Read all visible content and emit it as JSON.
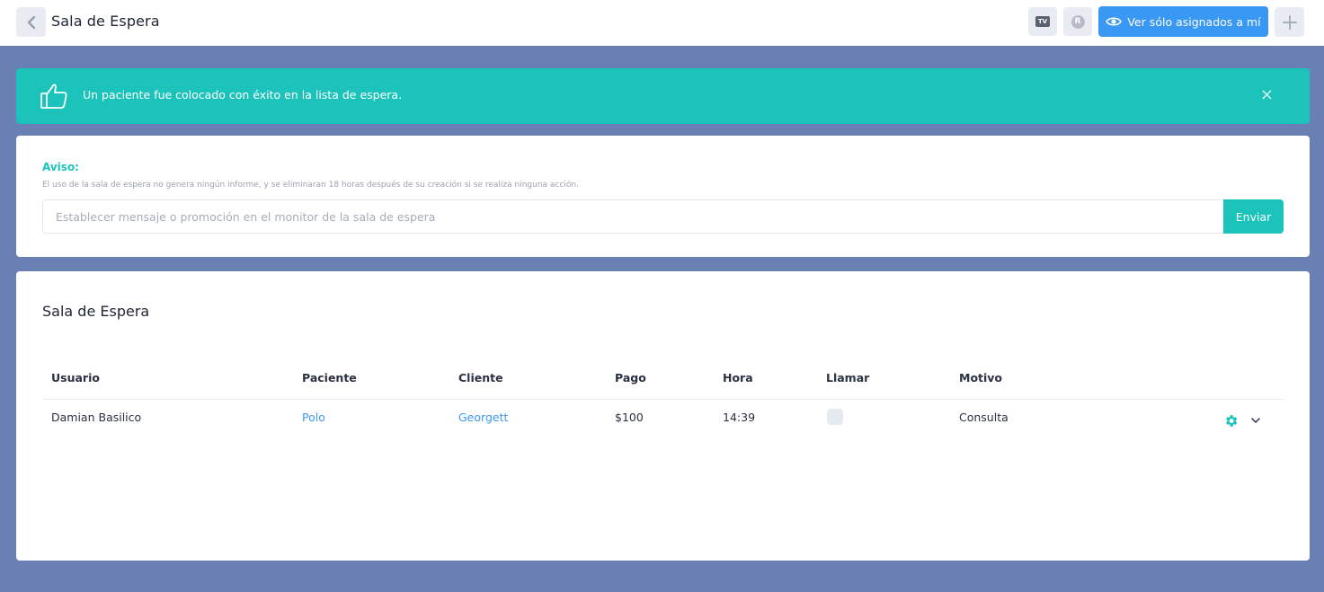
{
  "header": {
    "title": "Sala de Espera",
    "tv_label": "TV",
    "r_label": "R",
    "assigned_button": "Ver sólo asignados a mí"
  },
  "alert": {
    "message": "Un paciente fue colocado con éxito en la lista de espera.",
    "close": "×"
  },
  "notice": {
    "title": "Aviso:",
    "description": "El uso de la sala de espera no genera ningún informe, y se eliminaran 18 horas después de su creación si se realiza ninguna acción.",
    "input_placeholder": "Establecer mensaje o promoción en el monitor de la sala de espera",
    "input_value": "",
    "send_button": "Enviar"
  },
  "waiting_room": {
    "title": "Sala de Espera",
    "columns": [
      "Usuario",
      "Paciente",
      "Cliente",
      "Pago",
      "Hora",
      "Llamar",
      "Motivo"
    ],
    "rows": [
      {
        "usuario": "Damian Basilico",
        "paciente": "Polo",
        "cliente": "Georgett",
        "pago": "$100",
        "hora": "14:39",
        "llamar": false,
        "motivo": "Consulta"
      }
    ]
  },
  "colors": {
    "accent_teal": "#1cc3bb",
    "primary_blue": "#3a98f5",
    "background": "#6a7fb3"
  },
  "icons": [
    "chevron-left-icon",
    "tv-icon",
    "r-icon",
    "eye-icon",
    "plus-icon",
    "thumbs-up-icon",
    "close-icon",
    "gear-icon",
    "chevron-down-icon"
  ]
}
